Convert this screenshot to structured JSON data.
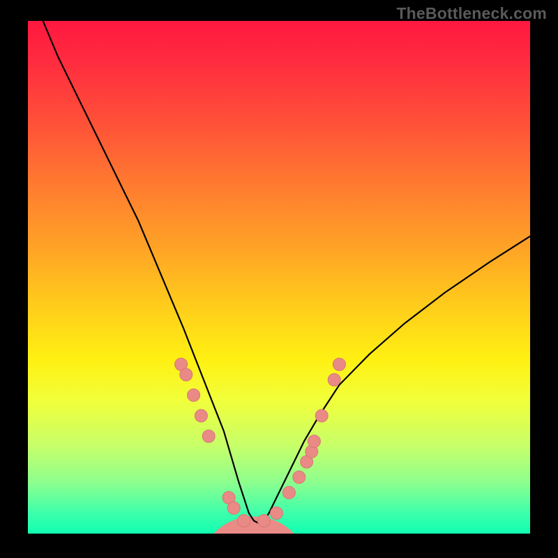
{
  "watermark": "TheBottleneck.com",
  "colors": {
    "background": "#000000",
    "curve": "#000000",
    "marker_fill": "#e98a86",
    "marker_stroke": "#d77773",
    "hump_fill": "#ea8b87"
  },
  "chart_data": {
    "type": "line",
    "title": "",
    "xlabel": "",
    "ylabel": "",
    "xlim": [
      0,
      100
    ],
    "ylim": [
      0,
      100
    ],
    "series": [
      {
        "name": "bottleneck-curve",
        "x": [
          3,
          6,
          10,
          14,
          18,
          22,
          25,
          28,
          31,
          33,
          35,
          37,
          39,
          40.5,
          42,
          43,
          44,
          45,
          46,
          47,
          48,
          49.5,
          51,
          53,
          55,
          58,
          62,
          68,
          75,
          83,
          92,
          100
        ],
        "y": [
          100,
          93,
          85,
          77,
          69,
          61,
          54,
          47,
          40,
          35,
          30,
          25,
          20,
          15,
          10,
          7,
          4,
          2.5,
          2,
          2.5,
          4,
          7,
          10,
          14,
          18,
          23,
          29,
          35,
          41,
          47,
          53,
          58
        ]
      }
    ],
    "markers": {
      "name": "data-points",
      "points": [
        {
          "x": 30.5,
          "y": 33
        },
        {
          "x": 31.5,
          "y": 31
        },
        {
          "x": 33.0,
          "y": 27
        },
        {
          "x": 34.5,
          "y": 23
        },
        {
          "x": 36.0,
          "y": 19
        },
        {
          "x": 40.0,
          "y": 7
        },
        {
          "x": 41.0,
          "y": 5
        },
        {
          "x": 43.0,
          "y": 2.5
        },
        {
          "x": 47.0,
          "y": 2.5
        },
        {
          "x": 49.5,
          "y": 4
        },
        {
          "x": 52.0,
          "y": 8
        },
        {
          "x": 54.0,
          "y": 11
        },
        {
          "x": 55.5,
          "y": 14
        },
        {
          "x": 56.5,
          "y": 16
        },
        {
          "x": 57.0,
          "y": 18
        },
        {
          "x": 58.5,
          "y": 23
        },
        {
          "x": 61.0,
          "y": 30
        },
        {
          "x": 62.0,
          "y": 33
        }
      ]
    },
    "hump": {
      "center_x": 45,
      "base_y": 0,
      "top_y": 2.5,
      "half_width": 8
    }
  }
}
